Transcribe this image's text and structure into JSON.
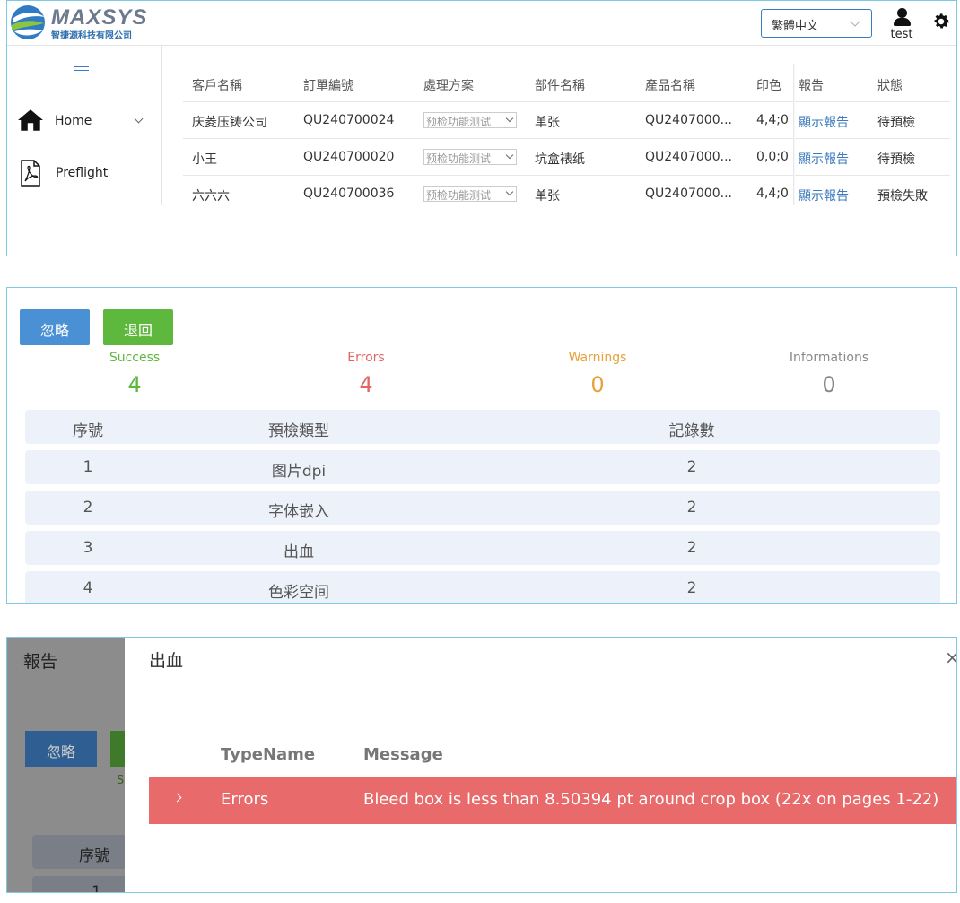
{
  "header": {
    "brand": "MAXSYS",
    "company": "智捷源科技有限公司",
    "language": "繁體中文",
    "user_name": "test"
  },
  "sidebar": {
    "items": [
      {
        "label": "Home",
        "icon": "home-icon"
      },
      {
        "label": "Preflight",
        "icon": "pdf-icon"
      }
    ]
  },
  "orders": {
    "columns": [
      "客戶名稱",
      "訂單編號",
      "處理方案",
      "部件名稱",
      "產品名稱",
      "印色",
      "報告",
      "狀態"
    ],
    "rows": [
      {
        "customer": "庆菱压铸公司",
        "order_no": "QU240700024",
        "plan": "预检功能测试",
        "part": "单张",
        "product": "QU2407000...",
        "color": "4,4;0,",
        "report": "顯示報告",
        "status": "待預檢"
      },
      {
        "customer": "小王",
        "order_no": "QU240700020",
        "plan": "预检功能测试",
        "part": "坑盒裱纸",
        "product": "QU2407000...",
        "color": "0,0;0,",
        "report": "顯示報告",
        "status": "待預檢"
      },
      {
        "customer": "六六六",
        "order_no": "QU240700036",
        "plan": "预检功能测试",
        "part": "单张",
        "product": "QU2407000...",
        "color": "4,4;0,",
        "report": "顯示報告",
        "status": "預檢失敗"
      }
    ]
  },
  "report": {
    "ignore_label": "忽略",
    "return_label": "退回",
    "stats": [
      {
        "label": "Success",
        "value": "4",
        "color": "#5fb83e"
      },
      {
        "label": "Errors",
        "value": "4",
        "color": "#e06666"
      },
      {
        "label": "Warnings",
        "value": "0",
        "color": "#e5a23a"
      },
      {
        "label": "Informations",
        "value": "0",
        "color": "#888888"
      }
    ],
    "table": {
      "columns": [
        "序號",
        "預檢類型",
        "記錄數"
      ],
      "rows": [
        {
          "no": "1",
          "type": "图片dpi",
          "count": "2"
        },
        {
          "no": "2",
          "type": "字体嵌入",
          "count": "2"
        },
        {
          "no": "3",
          "type": "出血",
          "count": "2"
        },
        {
          "no": "4",
          "type": "色彩空间",
          "count": "2"
        }
      ]
    }
  },
  "background_page": {
    "title": "報告",
    "ignore_label": "忽略",
    "success_fragment": "S",
    "column_fragment": "序號",
    "row_fragment": "1"
  },
  "drawer": {
    "title": "出血",
    "close": "×",
    "columns": [
      "TypeName",
      "Message"
    ],
    "rows": [
      {
        "type": "Errors",
        "message": "Bleed box is less than 8.50394 pt around crop box (22x on pages 1-22)"
      }
    ]
  },
  "colors": {
    "accent": "#3b7bbf",
    "success": "#5fb83e",
    "error_row": "#e86a6a",
    "panel_border": "#7ec9e3"
  }
}
